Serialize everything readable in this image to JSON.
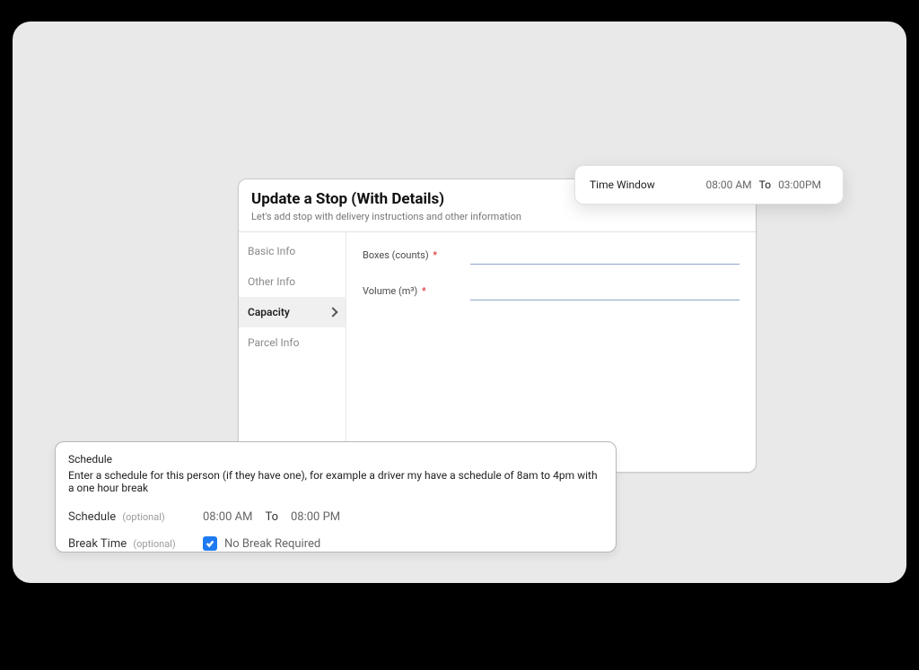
{
  "dialog": {
    "title": "Update a Stop (With Details)",
    "subtitle": "Let's add stop with delivery instructions and other information",
    "tabs": [
      {
        "label": "Basic Info"
      },
      {
        "label": "Other Info"
      },
      {
        "label": "Capacity"
      },
      {
        "label": "Parcel Info"
      }
    ],
    "fields": {
      "boxes": {
        "label": "Boxes (counts)",
        "required": true,
        "value": ""
      },
      "volume": {
        "label": "Volume (m³)",
        "required": true,
        "value": ""
      }
    }
  },
  "time_window": {
    "label": "Time Window",
    "from": "08:00 AM",
    "to_label": "To",
    "to": "03:00PM"
  },
  "schedule": {
    "title": "Schedule",
    "description": "Enter a schedule for this person (if they have one), for example a driver my have a schedule of 8am to 4pm with a one hour break",
    "schedule_label": "Schedule",
    "optional_label": "(optional)",
    "from": "08:00 AM",
    "to_label": "To",
    "to": "08:00 PM",
    "break_label": "Break Time",
    "no_break_checked": true,
    "no_break_label": "No Break Required"
  },
  "required_marker": "*"
}
